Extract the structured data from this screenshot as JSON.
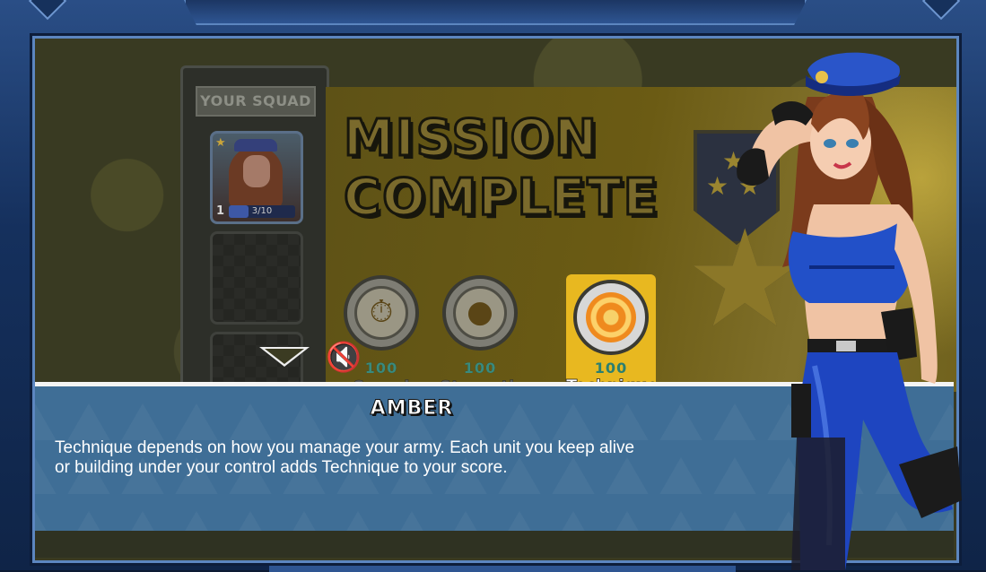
{
  "squad": {
    "title": "YOUR SQUAD",
    "unit": {
      "level": "1",
      "xp": "3/10",
      "xp_fraction": 0.3
    }
  },
  "mission": {
    "title_line1": "MISSION",
    "title_line2": "COMPLETE"
  },
  "scores": [
    {
      "label": "Speed",
      "value": "100",
      "icon": "stopwatch-icon"
    },
    {
      "label": "Strength",
      "value": "100",
      "icon": "bomb-icon"
    },
    {
      "label": "Technique",
      "value": "100",
      "icon": "target-icon"
    }
  ],
  "dialog": {
    "speaker": "AMBER",
    "line1": "Technique depends on how you manage your army. Each unit you keep alive",
    "line2": "or building under your control adds Technique to your score."
  },
  "colors": {
    "accent": "#e8b820",
    "dialog_bg": "#3f6e96",
    "frame": "#2a4e86"
  }
}
